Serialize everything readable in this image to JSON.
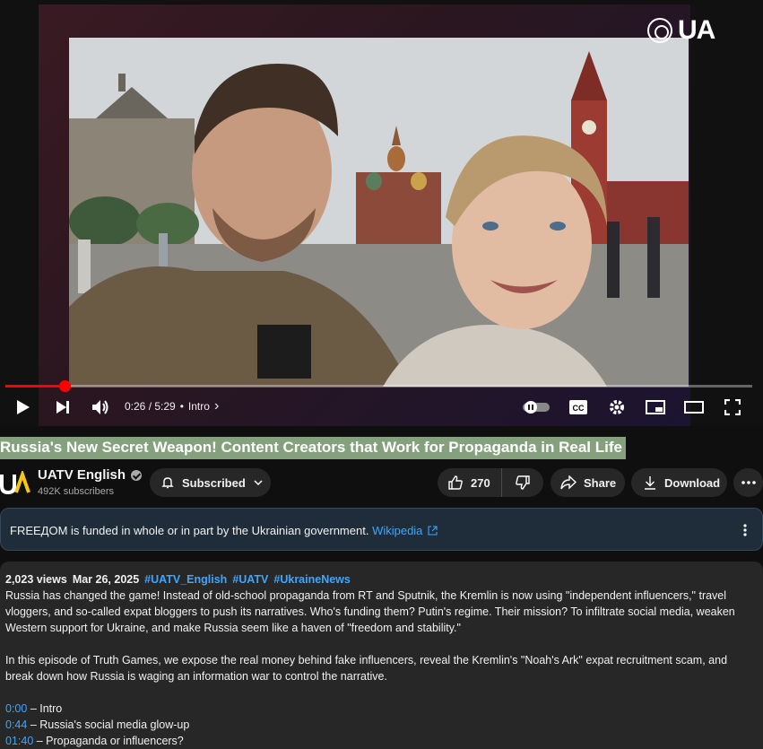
{
  "player": {
    "brand": "UA",
    "time": "0:26 / 5:29",
    "chapter_sep": "•",
    "chapter": "Intro",
    "chapter_arrow": "›",
    "progress_fraction": 0.079
  },
  "video": {
    "title": "Russia's New Secret Weapon! Content Creators that Work for Propaganda in Real Life"
  },
  "channel": {
    "avatar_text": "UA",
    "name": "UATV English",
    "subscribers": "492K subscribers",
    "subscribed_label": "Subscribed"
  },
  "actions": {
    "likes": "270",
    "share_label": "Share",
    "download_label": "Download"
  },
  "notice": {
    "text": "FREEДOM is funded in whole or in part by the Ukrainian government.",
    "link": "Wikipedia"
  },
  "description": {
    "views": "2,023 views",
    "date": "Mar 26, 2025",
    "tags": [
      "#UATV_English",
      "#UATV",
      "#UkraineNews"
    ],
    "para1": "Russia has changed the game! Instead of old-school propaganda from RT and Sputnik, the Kremlin is now using \"independent influencers,\" travel vloggers, and so-called expat bloggers to push its narratives. Who's funding them? Putin's regime. Their mission? To infiltrate social media, weaken Western support for Ukraine, and make Russia seem like a haven of \"freedom and stability.\"",
    "para2": "In this episode of Truth Games, we expose the real money behind fake influencers, reveal the Kremlin's \"Noah's Ark\" expat recruitment scam, and break down how Russia is waging an information war to control the narrative.",
    "chapters": [
      {
        "time": "0:00",
        "label": " – Intro"
      },
      {
        "time": "0:44",
        "label": " – Russia's social media glow-up"
      },
      {
        "time": "01:40",
        "label": " – Propaganda or influencers?"
      }
    ]
  },
  "colors": {
    "accent": "#ff0000",
    "link": "#3ea6ff",
    "title_highlight": "#84a07c",
    "notice_bg": "#1f2d3a"
  }
}
